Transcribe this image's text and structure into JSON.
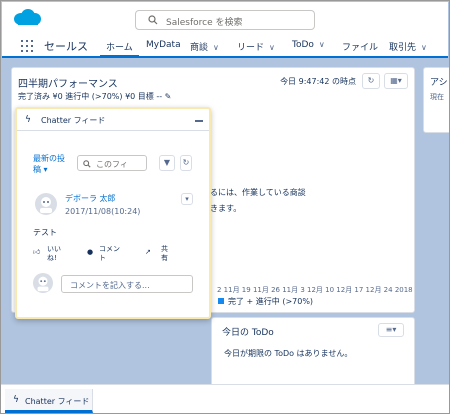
{
  "header": {
    "search_placeholder": "Salesforce を検索"
  },
  "nav": {
    "app_name": "セールス",
    "tabs": [
      {
        "label": "ホーム",
        "active": true,
        "has_menu": false
      },
      {
        "label": "MyData",
        "active": false,
        "has_menu": false
      },
      {
        "label": "商談",
        "active": false,
        "has_menu": true
      },
      {
        "label": "リード",
        "active": false,
        "has_menu": true
      },
      {
        "label": "ToDo",
        "active": false,
        "has_menu": true
      },
      {
        "label": "ファイル",
        "active": false,
        "has_menu": false
      },
      {
        "label": "取引先",
        "active": false,
        "has_menu": true
      }
    ]
  },
  "quarter": {
    "title": "四半期パフォーマンス",
    "stats": "完了済み ¥0   進行中 (>70%) ¥0   目標 --",
    "time": "今日 9:47:42 の時点",
    "message_line1": "るには、作業している商談",
    "message_line2": "きます。",
    "axis_ticks": "2 11月 19 11月 26 11月 3 12月 10 12月 17 12月 24 2018",
    "legend": "完了 + 進行中 (>70%)"
  },
  "side": {
    "title": "アシ",
    "sub": "現在"
  },
  "todo": {
    "title": "今日の ToDo",
    "empty": "今日が期限の ToDo はありません。"
  },
  "chatter": {
    "title": "Chatter フィード",
    "sort_line1": "最新の投",
    "sort_line2": "稿 ▾",
    "search_placeholder": "このフィ",
    "author": "デボーラ 太郎",
    "date": "2017/11/08(10:24)",
    "body": "テスト",
    "like_line1": "いい",
    "like_line2": "ね!",
    "comment_line1": "コメン",
    "comment_line2": "ト",
    "share_line1": "共",
    "share_line2": "有",
    "comment_placeholder": "コメントを記入する..."
  },
  "footer": {
    "label": "Chatter フィード"
  },
  "colors": {
    "brand": "#0070d2",
    "logo": "#00a1e0",
    "chatter_border": "#f7e9b0",
    "legend": "#1589ee"
  },
  "icons": [
    "salesforce-cloud-icon",
    "search-icon",
    "app-launcher-icon",
    "refresh-icon",
    "menu-icon",
    "pencil-icon",
    "bolt-icon",
    "minimize-icon",
    "filter-icon",
    "chevron-down-icon",
    "like-icon",
    "comment-icon",
    "share-icon",
    "user-avatar-icon"
  ]
}
